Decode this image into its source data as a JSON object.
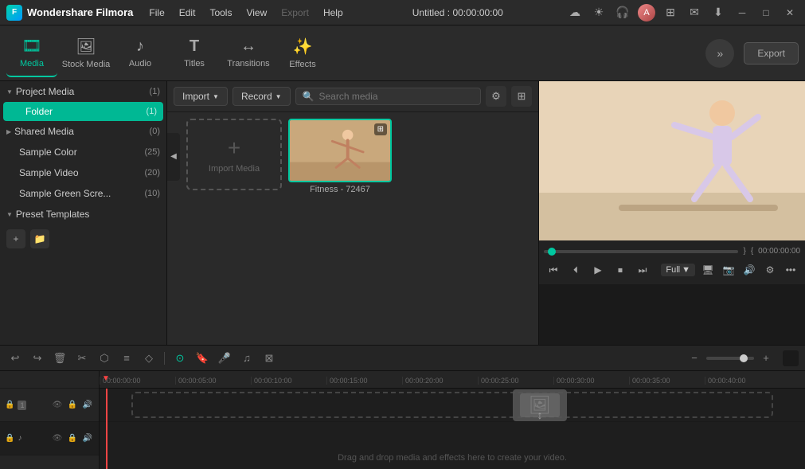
{
  "app": {
    "name": "Wondershare Filmora",
    "title": "Untitled : 00:00:00:00"
  },
  "menu": {
    "items": [
      "File",
      "Edit",
      "Tools",
      "View",
      "Export",
      "Help"
    ]
  },
  "toolbar": {
    "items": [
      {
        "id": "media",
        "label": "Media",
        "icon": "🎞",
        "active": true
      },
      {
        "id": "stock-media",
        "label": "Stock Media",
        "icon": "🖼",
        "active": false
      },
      {
        "id": "audio",
        "label": "Audio",
        "icon": "♪",
        "active": false
      },
      {
        "id": "titles",
        "label": "Titles",
        "icon": "T",
        "active": false
      },
      {
        "id": "transitions",
        "label": "Transitions",
        "icon": "↔",
        "active": false
      },
      {
        "id": "effects",
        "label": "Effects",
        "icon": "✨",
        "active": false
      }
    ],
    "export_label": "Export"
  },
  "left_panel": {
    "sections": [
      {
        "id": "project-media",
        "label": "Project Media",
        "count": "(1)",
        "expanded": true,
        "children": [
          {
            "id": "folder",
            "label": "Folder",
            "count": "(1)",
            "active": true
          }
        ]
      },
      {
        "id": "shared-media",
        "label": "Shared Media",
        "count": "(0)",
        "expanded": false
      },
      {
        "id": "sample-color",
        "label": "Sample Color",
        "count": "(25)",
        "expanded": false
      },
      {
        "id": "sample-video",
        "label": "Sample Video",
        "count": "(20)",
        "expanded": false
      },
      {
        "id": "sample-green",
        "label": "Sample Green Scre...",
        "count": "(10)",
        "expanded": false
      },
      {
        "id": "preset-templates",
        "label": "Preset Templates",
        "count": "",
        "expanded": true
      }
    ]
  },
  "media_area": {
    "import_label": "Import",
    "record_label": "Record",
    "search_placeholder": "Search media",
    "import_placeholder_label": "Import Media",
    "media_items": [
      {
        "id": "fitness",
        "label": "Fitness - 72467"
      }
    ]
  },
  "preview": {
    "time_current": "00:00:00:00",
    "time_total": "00:00:00:00",
    "zoom_label": "Full",
    "controls": [
      "skip-back",
      "step-back",
      "play",
      "stop",
      "skip-forward"
    ]
  },
  "timeline": {
    "zoom_minus": "−",
    "zoom_plus": "+",
    "ruler_ticks": [
      "00:00:00:00",
      "00:00:05:00",
      "00:00:10:00",
      "00:00:15:00",
      "00:00:20:00",
      "00:00:25:00",
      "00:00:30:00",
      "00:00:35:00",
      "00:00:40:00"
    ],
    "drop_zone_text": "Drag and drop media and effects here to create your video.",
    "tracks": [
      {
        "id": "video-track",
        "type": "video"
      },
      {
        "id": "audio-track",
        "type": "audio"
      }
    ]
  }
}
